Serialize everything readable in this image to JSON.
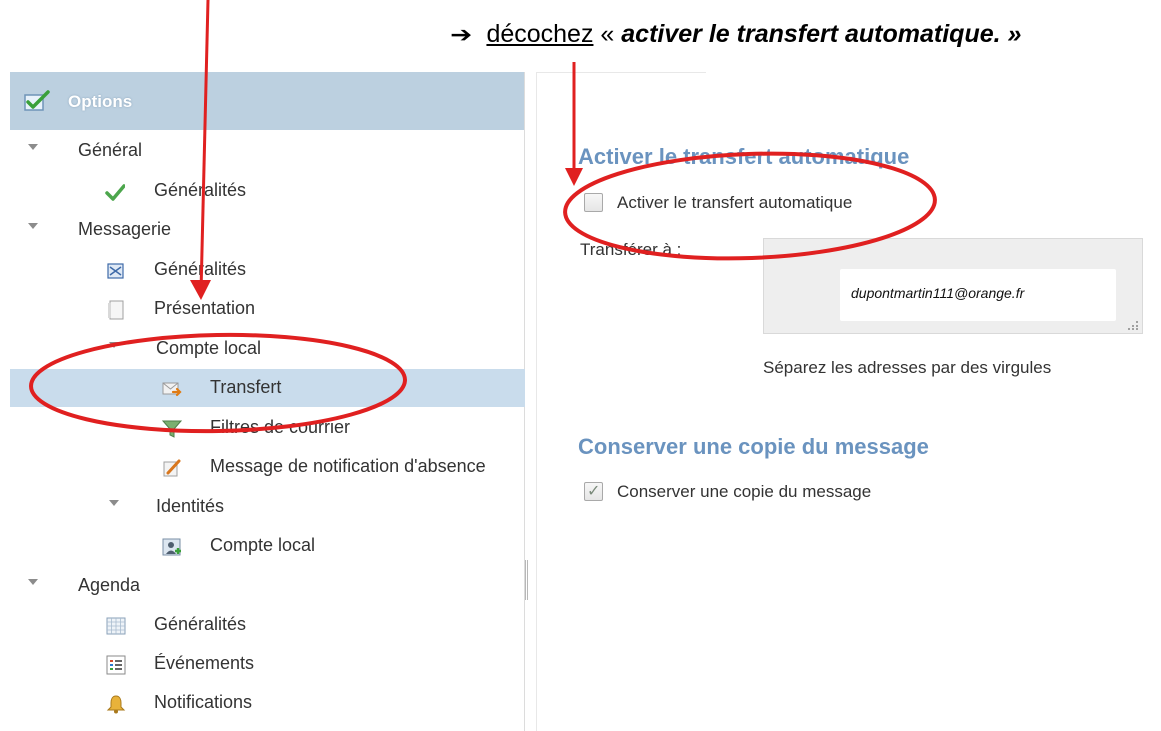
{
  "instruction": {
    "arrow": "➔",
    "verb": "décochez",
    "quote_open": "«",
    "quoted": "activer le transfert automatique.",
    "quote_close": "»"
  },
  "sidebar": {
    "header": {
      "title": "Options",
      "icon": "options-check-icon"
    },
    "items": [
      {
        "label": "Général",
        "icon": "",
        "expandable": true
      },
      {
        "label": "Généralités",
        "icon": "green-check-icon"
      },
      {
        "label": "Messagerie",
        "icon": "",
        "expandable": true
      },
      {
        "label": "Généralités",
        "icon": "mail-settings-icon"
      },
      {
        "label": "Présentation",
        "icon": "page-icon"
      },
      {
        "label": "Compte local",
        "icon": "",
        "expandable": true
      },
      {
        "label": "Transfert",
        "icon": "forward-mail-icon",
        "selected": true
      },
      {
        "label": "Filtres de courrier",
        "icon": "funnel-icon"
      },
      {
        "label": "Message de notification d'absence",
        "icon": "pencil-note-icon"
      },
      {
        "label": "Identités",
        "icon": "",
        "expandable": true
      },
      {
        "label": "Compte local",
        "icon": "identity-icon"
      },
      {
        "label": "Agenda",
        "icon": "",
        "expandable": true
      },
      {
        "label": "Généralités",
        "icon": "calendar-grid-icon"
      },
      {
        "label": "Événements",
        "icon": "list-icon"
      },
      {
        "label": "Notifications",
        "icon": "bell-icon"
      }
    ]
  },
  "main": {
    "autoforward": {
      "title": "Activer le transfert automatique",
      "checkbox_label": "Activer le transfert automatique",
      "checked": false,
      "forward_to_label": "Transférer à :",
      "forward_to_value": "dupontmartin111@orange.fr",
      "hint": "Séparez les adresses par des virgules"
    },
    "keep_copy": {
      "title": "Conserver une copie du message",
      "checkbox_label": "Conserver une copie du message",
      "checked": true
    }
  },
  "colors": {
    "annotation_red": "#e02020",
    "header_blue": "#bcd0e0",
    "selected_row": "#c9dcec",
    "section_title": "#6a93bf"
  }
}
